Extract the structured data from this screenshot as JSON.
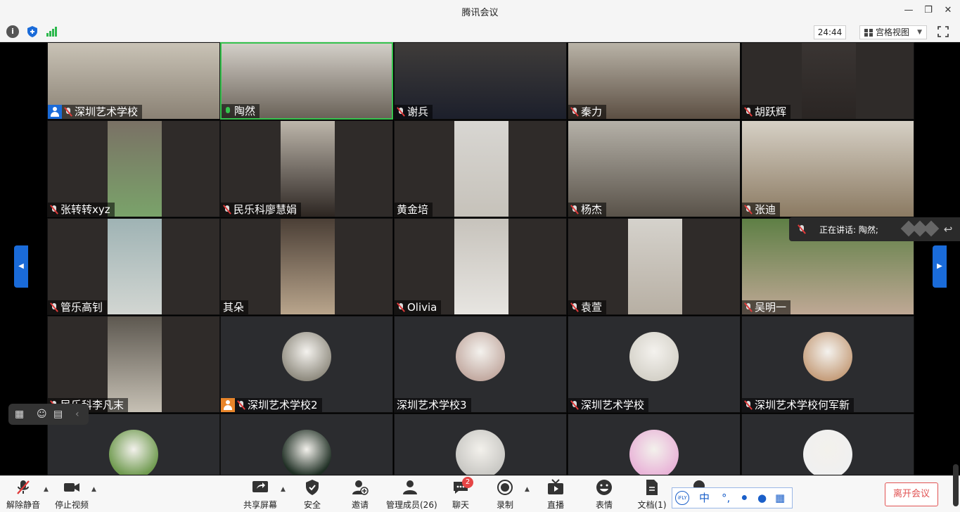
{
  "window": {
    "title": "腾讯会议"
  },
  "topbar": {
    "timer": "24:44",
    "view_label": "宫格视图"
  },
  "participants": [
    {
      "name": "深圳艺术学校",
      "host": true,
      "mic": "off"
    },
    {
      "name": "陶然",
      "mic": "on",
      "active": true
    },
    {
      "name": "谢兵",
      "mic": "off"
    },
    {
      "name": "秦力",
      "mic": "off"
    },
    {
      "name": "胡跃辉",
      "mic": "off"
    },
    {
      "name": "张转转xyz",
      "mic": "off"
    },
    {
      "name": "民乐科廖慧娟",
      "mic": "off"
    },
    {
      "name": "黄金培",
      "mic": "none"
    },
    {
      "name": "杨杰",
      "mic": "off"
    },
    {
      "name": "张迪",
      "mic": "off"
    },
    {
      "name": "管乐高钊",
      "mic": "off"
    },
    {
      "name": "其朵",
      "mic": "none"
    },
    {
      "name": "Olivia",
      "mic": "off"
    },
    {
      "name": "袁萱",
      "mic": "off"
    },
    {
      "name": "吴明一",
      "mic": "off"
    },
    {
      "name": "民乐科李凡末",
      "mic": "off"
    },
    {
      "name": "深圳艺术学校2",
      "host": true,
      "mic": "off"
    },
    {
      "name": "深圳艺术学校3",
      "mic": "none"
    },
    {
      "name": "深圳艺术学校",
      "mic": "off"
    },
    {
      "name": "深圳艺术学校何军新",
      "mic": "off"
    }
  ],
  "speaking": {
    "text": "正在讲话: 陶然;"
  },
  "toolbar": {
    "unmute": "解除静音",
    "stop_video": "停止视频",
    "share": "共享屏幕",
    "security": "安全",
    "invite": "邀请",
    "members": "管理成员(26)",
    "chat": "聊天",
    "chat_badge": "2",
    "record": "录制",
    "live": "直播",
    "emoji": "表情",
    "docs": "文档(1)",
    "leave": "离开会议"
  },
  "ime": {
    "brand": "iFLY",
    "lang": "中"
  }
}
